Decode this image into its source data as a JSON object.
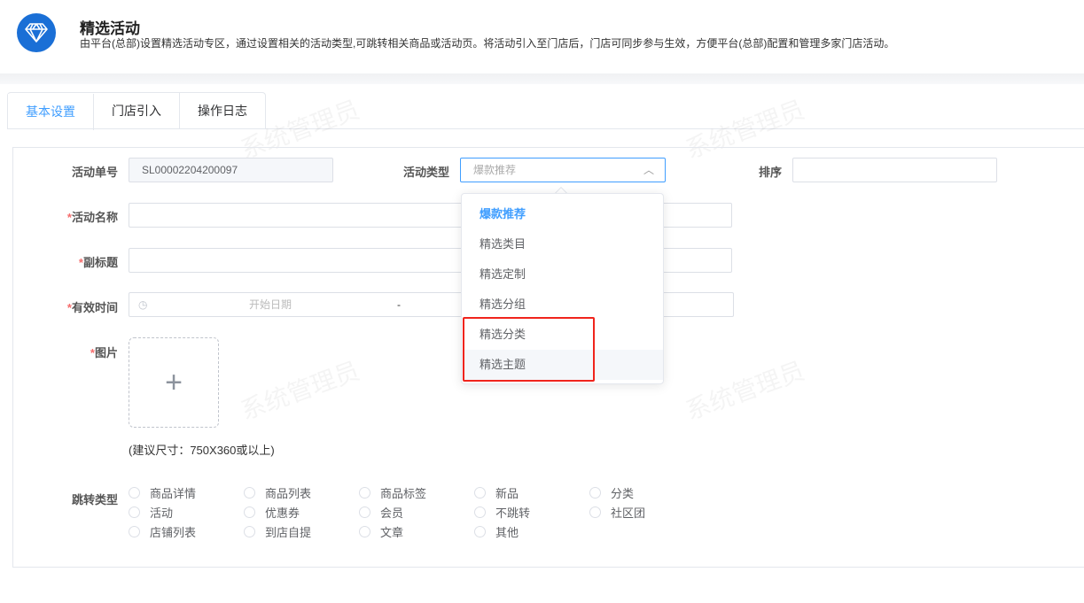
{
  "header": {
    "title": "精选活动",
    "description": "由平台(总部)设置精选活动专区，通过设置相关的活动类型,可跳转相关商品或活动页。将活动引入至门店后，门店可同步参与生效，方便平台(总部)配置和管理多家门店活动。"
  },
  "tabs": [
    {
      "label": "基本设置",
      "active": true
    },
    {
      "label": "门店引入"
    },
    {
      "label": "操作日志"
    }
  ],
  "watermark": "系统管理员",
  "form": {
    "order_no_label": "活动单号",
    "order_no": "SL00002204200097",
    "type_label": "活动类型",
    "type_value": "爆款推荐",
    "sort_label": "排序",
    "sort_value": "",
    "name_label": "活动名称",
    "subtitle_label": "副标题",
    "time_label": "有效时间",
    "start_placeholder": "开始日期",
    "separator": "-",
    "image_label": "图片",
    "image_hint": "(建议尺寸：750X360或以上)",
    "jump_label": "跳转类型",
    "jump_options": [
      "商品详情",
      "商品列表",
      "商品标签",
      "新品",
      "分类",
      "活动",
      "优惠券",
      "会员",
      "不跳转",
      "社区团",
      "店铺列表",
      "到店自提",
      "文章",
      "其他"
    ]
  },
  "dropdown": {
    "options": [
      "爆款推荐",
      "精选类目",
      "精选定制",
      "精选分组",
      "精选分类",
      "精选主题"
    ],
    "selected": "爆款推荐",
    "hovered": "精选主题"
  },
  "colors": {
    "accent": "#409eff",
    "highlight": "#f0241c",
    "logo": "#1a6fd6"
  }
}
